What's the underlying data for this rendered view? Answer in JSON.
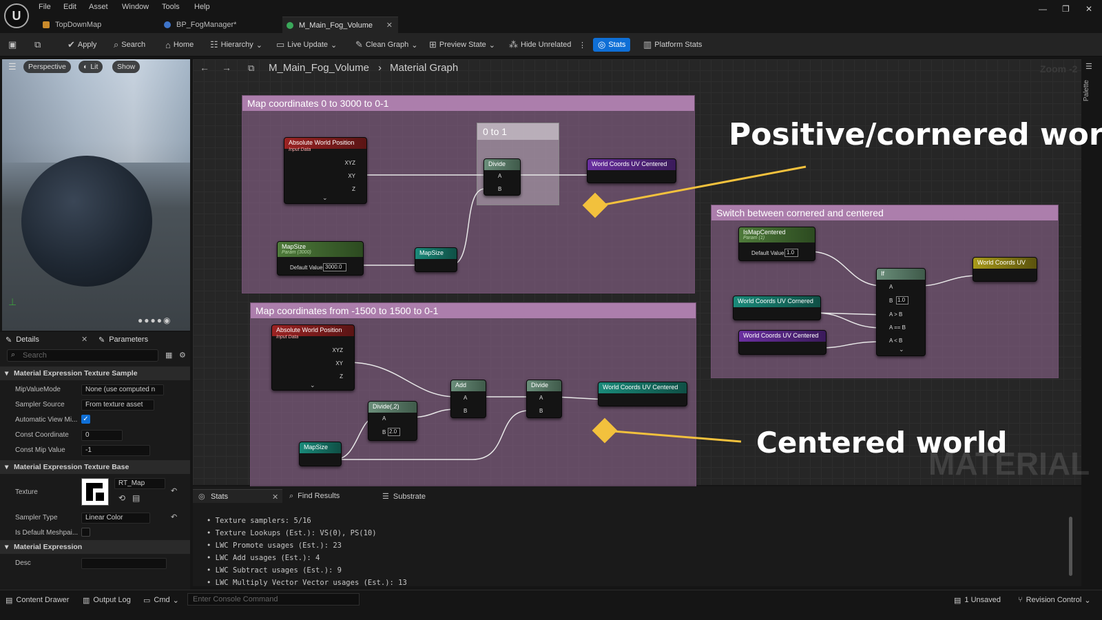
{
  "menu": [
    "File",
    "Edit",
    "Asset",
    "Window",
    "Tools",
    "Help"
  ],
  "tabs": [
    {
      "label": "TopDownMap",
      "active": false
    },
    {
      "label": "BP_FogManager*",
      "active": false
    },
    {
      "label": "M_Main_Fog_Volume",
      "active": true
    }
  ],
  "toolbar": {
    "apply": "Apply",
    "search": "Search",
    "home": "Home",
    "hierarchy": "Hierarchy",
    "live_update": "Live Update",
    "clean_graph": "Clean Graph",
    "preview_state": "Preview State",
    "hide_unrelated": "Hide Unrelated",
    "stats": "Stats",
    "platform_stats": "Platform Stats"
  },
  "viewport": {
    "perspective": "Perspective",
    "lit": "Lit",
    "show": "Show"
  },
  "details": {
    "tab_details": "Details",
    "tab_parameters": "Parameters",
    "search_placeholder": "Search",
    "sections": [
      {
        "title": "Material Expression Texture Sample",
        "props": [
          {
            "label": "MipValueMode",
            "value": "None (use computed n"
          },
          {
            "label": "Sampler Source",
            "value": "From texture asset"
          },
          {
            "label": "Automatic View Mi...",
            "value": "checked"
          },
          {
            "label": "Const Coordinate",
            "value": "0"
          },
          {
            "label": "Const Mip Value",
            "value": "-1"
          }
        ]
      },
      {
        "title": "Material Expression Texture Base",
        "props": [
          {
            "label": "Texture",
            "value": "RT_Map"
          },
          {
            "label": "Sampler Type",
            "value": "Linear Color"
          },
          {
            "label": "Is Default Meshpai...",
            "value": "unchecked"
          }
        ]
      },
      {
        "title": "Material Expression",
        "props": [
          {
            "label": "Desc",
            "value": ""
          }
        ]
      }
    ]
  },
  "graph": {
    "breadcrumb_asset": "M_Main_Fog_Volume",
    "breadcrumb_graph": "Material Graph",
    "zoom": "Zoom -2",
    "palette": "Palette",
    "comments": {
      "c1": "Map coordinates 0 to 3000 to 0-1",
      "c1_inner": "0 to 1",
      "c2": "Map coordinates from -1500 to 1500 to 0-1",
      "c3": "Switch between cornered and centered"
    },
    "nodes": {
      "awp1": "Absolute World Position",
      "awp_sub": "Input Data",
      "mapsize_param": "MapSize",
      "mapsize_param_sub": "Param (3000)",
      "default_value_label": "Default Value",
      "mapsize_default": "3000.0",
      "mapsize_ref": "MapSize",
      "divide": "Divide",
      "wc_uv_centered": "World Coords UV Centered",
      "awp2": "Absolute World Position",
      "add": "Add",
      "divide2": "Divide",
      "divide_2": "Divide(,2)",
      "divide_2_b": "2.0",
      "mapsize_ref2": "MapSize",
      "wc_uv_cornered": "World Coords UV Cornered",
      "ismapcentered": "IsMapCentered",
      "ismapcentered_sub": "Param (1)",
      "ismapcentered_default": "1.0",
      "if": "If",
      "if_b": "1.0",
      "wc_uv_cornered2": "World Coords UV Cornered",
      "wc_uv_centered2": "World Coords UV Centered",
      "wc_uv": "World Coords UV"
    },
    "pins": {
      "xyz": "XYZ",
      "xy": "XY",
      "z": "Z",
      "a": "A",
      "b": "B",
      "agtb": "A > B",
      "aeqb": "A == B",
      "altb": "A < B"
    },
    "annotation_top": "Positive/cornered world",
    "annotation_bottom": "Centered world",
    "watermark": "MATERIAL"
  },
  "bottom": {
    "tab_stats": "Stats",
    "tab_find": "Find Results",
    "tab_substrate": "Substrate",
    "stats": [
      "Texture samplers: 5/16",
      "Texture Lookups (Est.): VS(0), PS(10)",
      "LWC Promote usages (Est.): 23",
      "LWC Add usages (Est.): 4",
      "LWC Subtract usages (Est.): 9",
      "LWC Multiply Vector Vector usages (Est.): 13"
    ]
  },
  "statusbar": {
    "content_drawer": "Content Drawer",
    "output_log": "Output Log",
    "cmd": "Cmd",
    "console_placeholder": "Enter Console Command",
    "unsaved": "1 Unsaved",
    "revision_control": "Revision Control"
  },
  "colors": {
    "accent": "#0f6fd6",
    "comment": "#b487b4",
    "param_green": "#4e7a3a",
    "input_red": "#9b2323",
    "named_reroute_purple": "#6a2fa0",
    "teal": "#1a8a7a",
    "yellow": "#f2c13d"
  }
}
